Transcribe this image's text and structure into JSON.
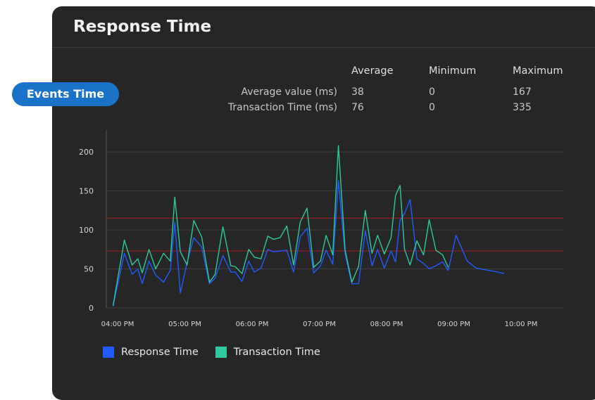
{
  "panel": {
    "title": "Response Time"
  },
  "badge": {
    "label": "Events Time"
  },
  "stats": {
    "headers": [
      "Average",
      "Minimum",
      "Maximum"
    ],
    "rows": [
      {
        "label": "Average value (ms)",
        "avg": "38",
        "min": "0",
        "max": "167"
      },
      {
        "label": "Transaction Time (ms)",
        "avg": "76",
        "min": "0",
        "max": "335"
      }
    ]
  },
  "colors": {
    "response": "#1f5cff",
    "transaction": "#2ec9a0",
    "threshold": "#8b1f1f",
    "panel": "#262626",
    "badge": "#1a73c9"
  },
  "chart_data": {
    "type": "line",
    "ylim": [
      0,
      210
    ],
    "yticks": [
      0,
      50,
      100,
      150,
      200
    ],
    "xtick_labels": [
      "04:00 PM",
      "05:00 PM",
      "06:00 PM",
      "07:00 PM",
      "08:00 PM",
      "09:00 PM",
      "10:00 PM"
    ],
    "threshold_lines": [
      115,
      73
    ],
    "grid": "horizontal",
    "legend_position": "bottom-left",
    "x": [
      "03:56 PM",
      "04:06 PM",
      "04:13 PM",
      "04:18 PM",
      "04:22 PM",
      "04:28 PM",
      "04:34 PM",
      "04:41 PM",
      "04:47 PM",
      "04:51 PM",
      "04:56 PM",
      "05:02 PM",
      "05:08 PM",
      "05:15 PM",
      "05:22 PM",
      "05:27 PM",
      "05:34 PM",
      "05:41 PM",
      "05:45 PM",
      "05:51 PM",
      "05:57 PM",
      "06:02 PM",
      "06:08 PM",
      "06:14 PM",
      "06:19 PM",
      "06:25 PM",
      "06:31 PM",
      "06:37 PM",
      "06:43 PM",
      "06:49 PM",
      "06:55 PM",
      "07:01 PM",
      "07:06 PM",
      "07:12 PM",
      "07:17 PM",
      "07:23 PM",
      "07:29 PM",
      "07:35 PM",
      "07:41 PM",
      "07:47 PM",
      "07:52 PM",
      "07:58 PM",
      "08:04 PM",
      "08:08 PM",
      "08:12 PM",
      "08:16 PM",
      "08:21 PM",
      "08:27 PM",
      "08:33 PM",
      "08:38 PM",
      "08:44 PM",
      "08:50 PM",
      "08:55 PM",
      "09:02 PM",
      "09:12 PM",
      "09:20 PM",
      "09:36 PM",
      "09:45 PM",
      "09:53 PM",
      "09:58 PM",
      "10:04 PM",
      "10:10 PM",
      "10:17 PM",
      "10:24 PM"
    ],
    "series": [
      {
        "name": "Response Time",
        "values": [
          2,
          70,
          43,
          50,
          31,
          60,
          42,
          33,
          48,
          110,
          19,
          58,
          90,
          78,
          31,
          38,
          67,
          46,
          46,
          34,
          60,
          46,
          51,
          75,
          72,
          73,
          74,
          46,
          91,
          102,
          45,
          54,
          74,
          56,
          163,
          69,
          31,
          31,
          99,
          54,
          75,
          51,
          73,
          59,
          112,
          121,
          139,
          63,
          57,
          50,
          54,
          59,
          48,
          93,
          60,
          51,
          47,
          44
        ]
      },
      {
        "name": "Transaction Time",
        "values": [
          3,
          87,
          55,
          63,
          45,
          75,
          50,
          70,
          60,
          142,
          72,
          55,
          112,
          91,
          33,
          43,
          104,
          54,
          53,
          44,
          75,
          65,
          63,
          92,
          88,
          90,
          105,
          55,
          110,
          128,
          52,
          60,
          93,
          68,
          208,
          74,
          33,
          53,
          125,
          70,
          93,
          69,
          90,
          144,
          157,
          75,
          55,
          86,
          68,
          113,
          74,
          68,
          52
        ]
      }
    ]
  },
  "legend": [
    {
      "label": "Response Time",
      "color": "#1f5cff"
    },
    {
      "label": "Transaction Time",
      "color": "#2ec9a0"
    }
  ]
}
